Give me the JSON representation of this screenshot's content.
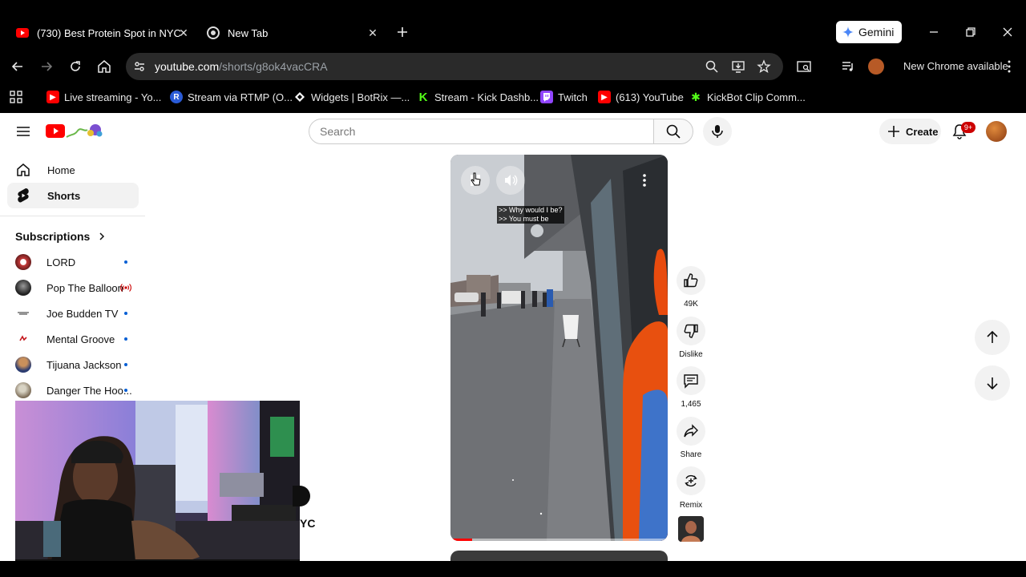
{
  "browser": {
    "tabs": [
      {
        "title": "(730) Best Protein Spot in NYC",
        "icon": "youtube-favicon",
        "active": true
      },
      {
        "title": "New Tab",
        "icon": "chrome-favicon",
        "active": false
      }
    ],
    "gemini_label": "Gemini",
    "url_host": "youtube.com",
    "url_path": "/shorts/g8ok4vacCRA",
    "new_chrome_label": "New Chrome available",
    "bookmarks": [
      {
        "label": "Live streaming - Yo...",
        "icon": "youtube-icon",
        "color": "#ff0000"
      },
      {
        "label": "Stream via RTMP (O...",
        "icon": "restream-icon",
        "color": "#2a5bd7"
      },
      {
        "label": "Widgets | BotRix —...",
        "icon": "botrix-icon",
        "color": "#ffffff"
      },
      {
        "label": "Stream - Kick Dashb...",
        "icon": "kick-icon",
        "color": "#53fc18"
      },
      {
        "label": "Twitch",
        "icon": "twitch-icon",
        "color": "#9146ff"
      },
      {
        "label": "(613) YouTube",
        "icon": "youtube-icon",
        "color": "#ff0000"
      },
      {
        "label": "KickBot Clip Comm...",
        "icon": "kickbot-icon",
        "color": "#53fc18"
      }
    ]
  },
  "youtube": {
    "search_placeholder": "Search",
    "create_label": "Create",
    "notifications_badge": "9+",
    "sidebar": {
      "items": [
        {
          "label": "Home",
          "icon": "home-icon"
        },
        {
          "label": "Shorts",
          "icon": "shorts-icon",
          "active": true
        }
      ],
      "subscriptions_label": "Subscriptions",
      "subscriptions": [
        {
          "name": "LORD",
          "status": "new"
        },
        {
          "name": "Pop The Balloon",
          "status": "live"
        },
        {
          "name": "Joe Budden TV",
          "status": "new"
        },
        {
          "name": "Mental Groove",
          "status": "new"
        },
        {
          "name": "Tijuana Jackson",
          "status": "new"
        },
        {
          "name": "Danger The Hoo...",
          "status": "new"
        }
      ]
    },
    "short": {
      "caption_lines": ">> Why would I be?\n>> You must be",
      "overlay_partial_text": "YC",
      "progress": 0.1
    },
    "actions": {
      "likes": "49K",
      "dislike_label": "Dislike",
      "comments": "1,465",
      "share_label": "Share",
      "remix_label": "Remix"
    }
  },
  "colors": {
    "youtube_red": "#ff0000",
    "notification_red": "#cc0000",
    "subscription_dot": "#065fd4"
  }
}
